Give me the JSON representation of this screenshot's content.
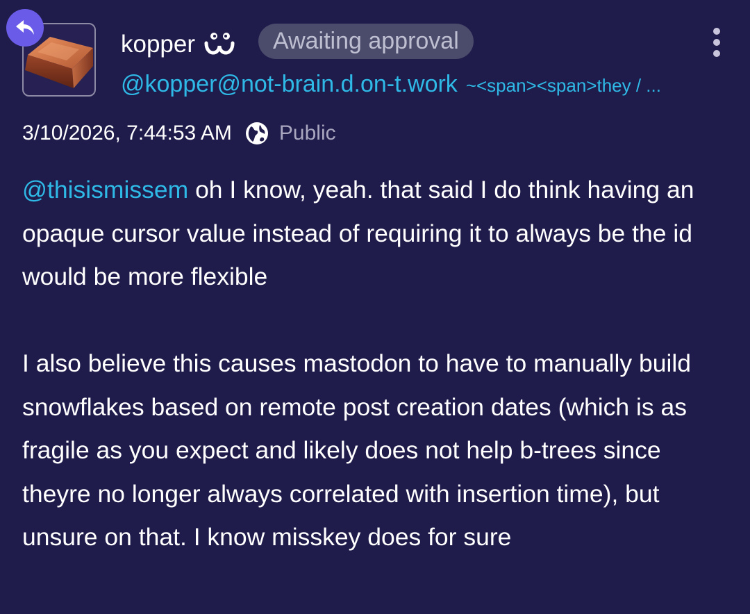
{
  "post": {
    "author": {
      "display_name": "kopper",
      "emoji_name": "uwu-face",
      "handle": "@kopper@not-brain.d.on-t.work",
      "pronouns": "~<span><span>they / ..."
    },
    "status_badge": "Awaiting approval",
    "reply_indicator_icon": "reply-arrow-icon",
    "menu_icon": "more-vertical-icon",
    "timestamp": "3/10/2026, 7:44:53 AM",
    "visibility_icon": "globe-icon",
    "visibility": "Public",
    "content": {
      "mention": "@thisismissem",
      "paragraph1_rest": " oh I know, yeah. that said I do think having an opaque cursor value instead of requiring it to always be the id would be more flexible",
      "paragraph2": "I also believe this causes mastodon to have to manually build snowflakes based on remote post creation dates (which is as fragile as you expect and likely does not help b-trees since theyre no longer always correlated with insertion time), but unsure on that. I know misskey does for sure"
    }
  },
  "colors": {
    "background": "#1f1b4a",
    "link": "#2fb9e6",
    "badge_bg": "#4b4b6b",
    "badge_text": "#bfbfd2",
    "reply_badge": "#6a5ce8",
    "muted_text": "#a9a7c0"
  }
}
